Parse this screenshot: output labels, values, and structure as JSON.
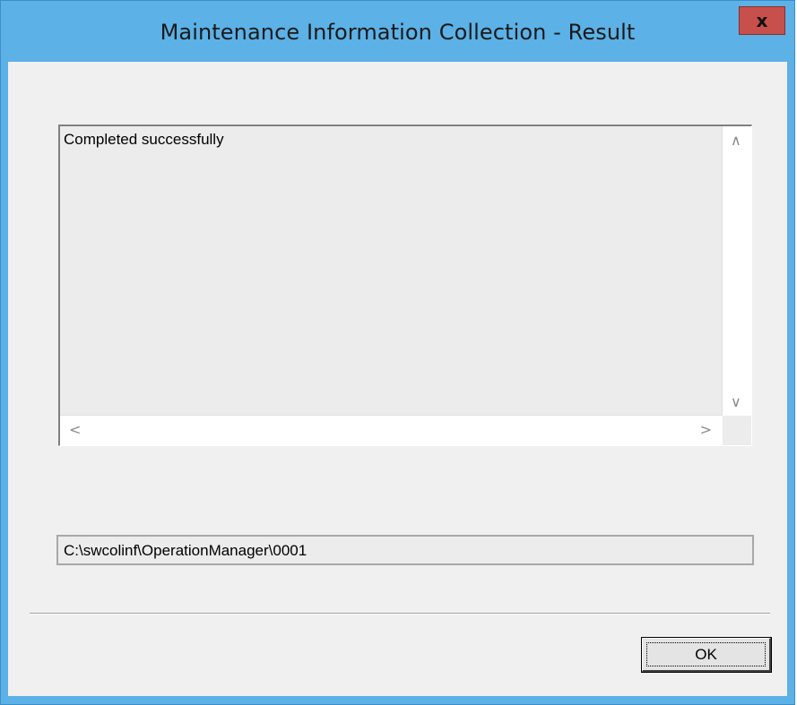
{
  "window": {
    "title": "Maintenance Information Collection - Result",
    "close_glyph": "x"
  },
  "result_box": {
    "text": "Completed successfully",
    "scroll_up_glyph": "∧",
    "scroll_down_glyph": "∨",
    "scroll_left_glyph": "<",
    "scroll_right_glyph": ">"
  },
  "output_path": {
    "value": "C:\\swcolinf\\OperationManager\\0001"
  },
  "buttons": {
    "ok_label": "OK"
  },
  "colors": {
    "frame": "#5cb1e6",
    "close_button": "#c7504c",
    "client": "#f0f0f0"
  }
}
